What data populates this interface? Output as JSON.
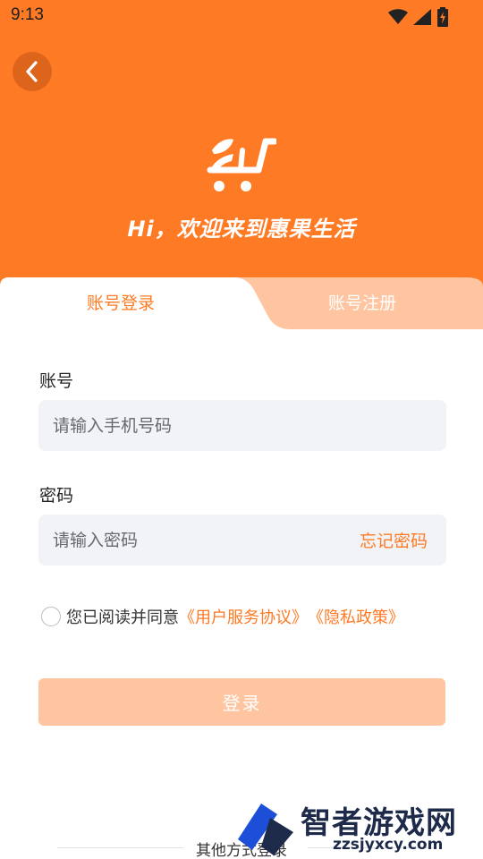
{
  "status_bar": {
    "time": "9:13",
    "icons": [
      "wifi-icon",
      "signal-icon",
      "battery-icon"
    ]
  },
  "header": {
    "welcome": "Hi，欢迎来到惠果生活",
    "logo": "shopping-cart-leaf-icon",
    "background": "#ff7a24"
  },
  "tabs": {
    "login": "账号登录",
    "register": "账号注册"
  },
  "form": {
    "account_label": "账号",
    "account_placeholder": "请输入手机号码",
    "password_label": "密码",
    "password_placeholder": "请输入密码",
    "forgot_password": "忘记密码"
  },
  "agreement": {
    "prefix": "您已阅读并同意",
    "user_agreement": "《用户服务协议》",
    "privacy_policy": "《隐私政策》"
  },
  "login_button": "登录",
  "other_methods": "其他方式登录",
  "watermark": {
    "title": "智者游戏网",
    "subtitle": "zzsjyxcy.com"
  },
  "colors": {
    "accent": "#ff7a24",
    "button_disabled": "#ffc5a0",
    "field_bg": "#f1f3f6"
  }
}
